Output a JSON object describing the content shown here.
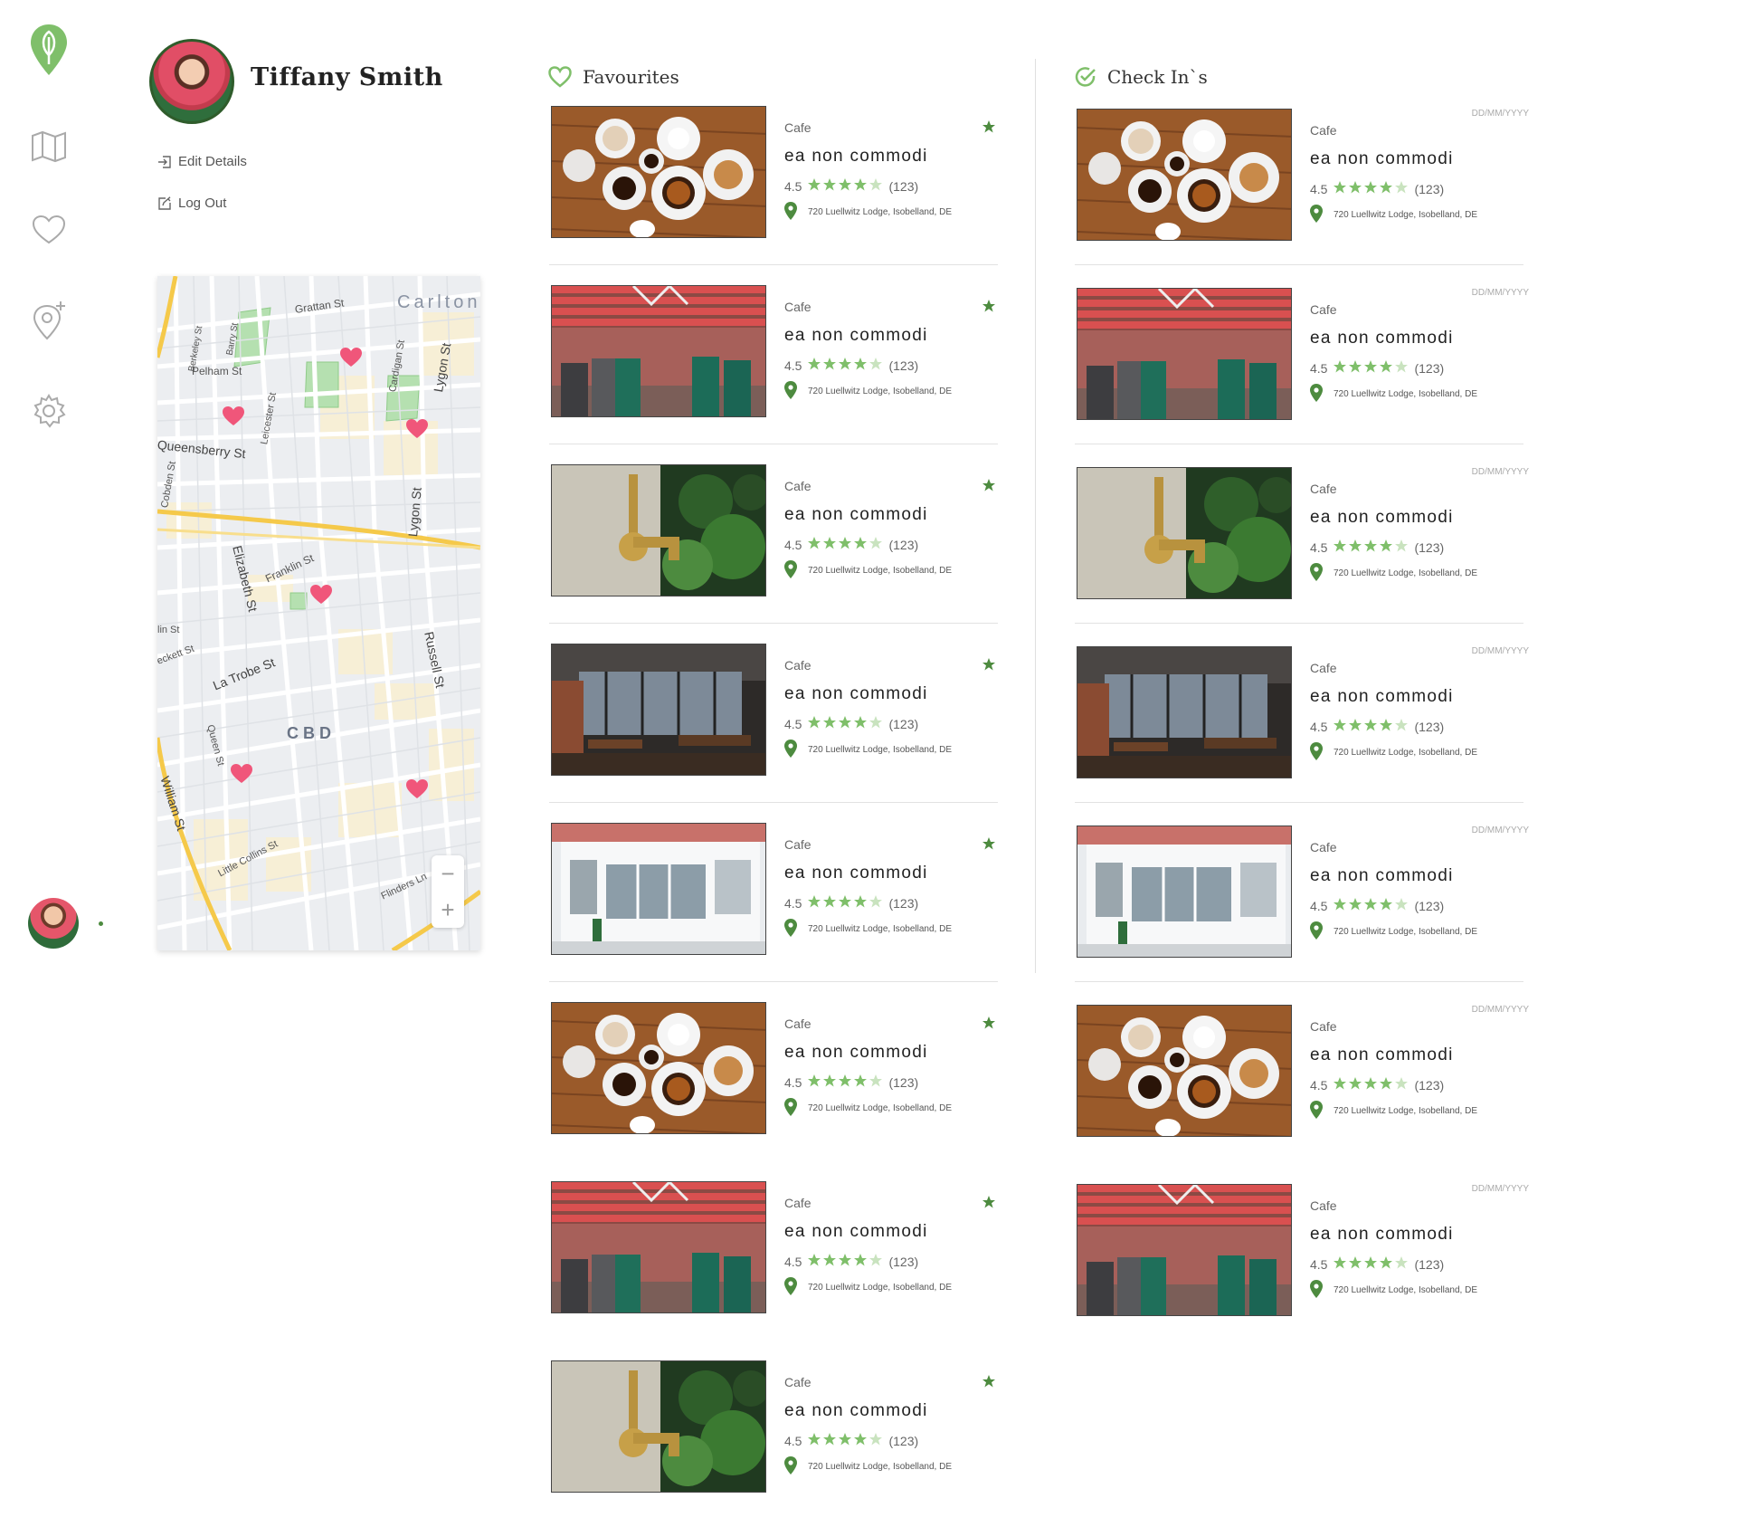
{
  "nav": {
    "items": [
      "home-leaf-icon",
      "map-icon",
      "heart-icon",
      "location-add-icon",
      "settings-icon"
    ]
  },
  "profile": {
    "name": "Tiffany Smith",
    "edit_label": "Edit Details",
    "logout_label": "Log Out"
  },
  "map": {
    "labels": {
      "carlton": "Carlton",
      "cbd": "CBD",
      "grattan": "Grattan St",
      "berkeley": "Berkeley St",
      "barry": "Barry St",
      "pelham": "Pelham St",
      "leicester": "Leicester St",
      "cardigan": "Cardigan St",
      "lygon1": "Lygon St",
      "lygon2": "Lygon St",
      "queensberry": "Queensberry St",
      "cobden": "Cobden St",
      "elizabeth": "Elizabeth St",
      "franklin": "Franklin St",
      "russell": "Russell St",
      "lin": "lin St",
      "eckett": "eckett St",
      "latrobe": "La Trobe St",
      "queen": "Queen St",
      "william": "William St",
      "littlecollins": "Little Collins St",
      "flinders": "Flinders Ln"
    }
  },
  "favourites": {
    "heading": "Favourites",
    "items": [
      {
        "category": "Cafe",
        "name": "ea non commodi",
        "rating": "4.5",
        "reviews": "(123)",
        "address": "720 Luellwitz Lodge, Isobelland, DE"
      },
      {
        "category": "Cafe",
        "name": "ea non commodi",
        "rating": "4.5",
        "reviews": "(123)",
        "address": "720 Luellwitz Lodge, Isobelland, DE"
      },
      {
        "category": "Cafe",
        "name": "ea non commodi",
        "rating": "4.5",
        "reviews": "(123)",
        "address": "720 Luellwitz Lodge, Isobelland, DE"
      },
      {
        "category": "Cafe",
        "name": "ea non commodi",
        "rating": "4.5",
        "reviews": "(123)",
        "address": "720 Luellwitz Lodge, Isobelland, DE"
      },
      {
        "category": "Cafe",
        "name": "ea non commodi",
        "rating": "4.5",
        "reviews": "(123)",
        "address": "720 Luellwitz Lodge, Isobelland, DE"
      },
      {
        "category": "Cafe",
        "name": "ea non commodi",
        "rating": "4.5",
        "reviews": "(123)",
        "address": "720 Luellwitz Lodge, Isobelland, DE"
      },
      {
        "category": "Cafe",
        "name": "ea non commodi",
        "rating": "4.5",
        "reviews": "(123)",
        "address": "720 Luellwitz Lodge, Isobelland, DE"
      },
      {
        "category": "Cafe",
        "name": "ea non commodi",
        "rating": "4.5",
        "reviews": "(123)",
        "address": "720 Luellwitz Lodge, Isobelland, DE"
      }
    ]
  },
  "checkins": {
    "heading": "Check In`s",
    "items": [
      {
        "date": "DD/MM/YYYY",
        "category": "Cafe",
        "name": "ea non commodi",
        "rating": "4.5",
        "reviews": "(123)",
        "address": "720 Luellwitz Lodge, Isobelland, DE"
      },
      {
        "date": "DD/MM/YYYY",
        "category": "Cafe",
        "name": "ea non commodi",
        "rating": "4.5",
        "reviews": "(123)",
        "address": "720 Luellwitz Lodge, Isobelland, DE"
      },
      {
        "date": "DD/MM/YYYY",
        "category": "Cafe",
        "name": "ea non commodi",
        "rating": "4.5",
        "reviews": "(123)",
        "address": "720 Luellwitz Lodge, Isobelland, DE"
      },
      {
        "date": "DD/MM/YYYY",
        "category": "Cafe",
        "name": "ea non commodi",
        "rating": "4.5",
        "reviews": "(123)",
        "address": "720 Luellwitz Lodge, Isobelland, DE"
      },
      {
        "date": "DD/MM/YYYY",
        "category": "Cafe",
        "name": "ea non commodi",
        "rating": "4.5",
        "reviews": "(123)",
        "address": "720 Luellwitz Lodge, Isobelland, DE"
      },
      {
        "date": "DD/MM/YYYY",
        "category": "Cafe",
        "name": "ea non commodi",
        "rating": "4.5",
        "reviews": "(123)",
        "address": "720 Luellwitz Lodge, Isobelland, DE"
      },
      {
        "date": "DD/MM/YYYY",
        "category": "Cafe",
        "name": "ea non commodi",
        "rating": "4.5",
        "reviews": "(123)",
        "address": "720 Luellwitz Lodge, Isobelland, DE"
      }
    ]
  },
  "colors": {
    "brand_green": "#4d8b3f",
    "star_green": "#7fbf6a",
    "star_empty": "#c9e3bf",
    "map_heart": "#f0567a"
  }
}
